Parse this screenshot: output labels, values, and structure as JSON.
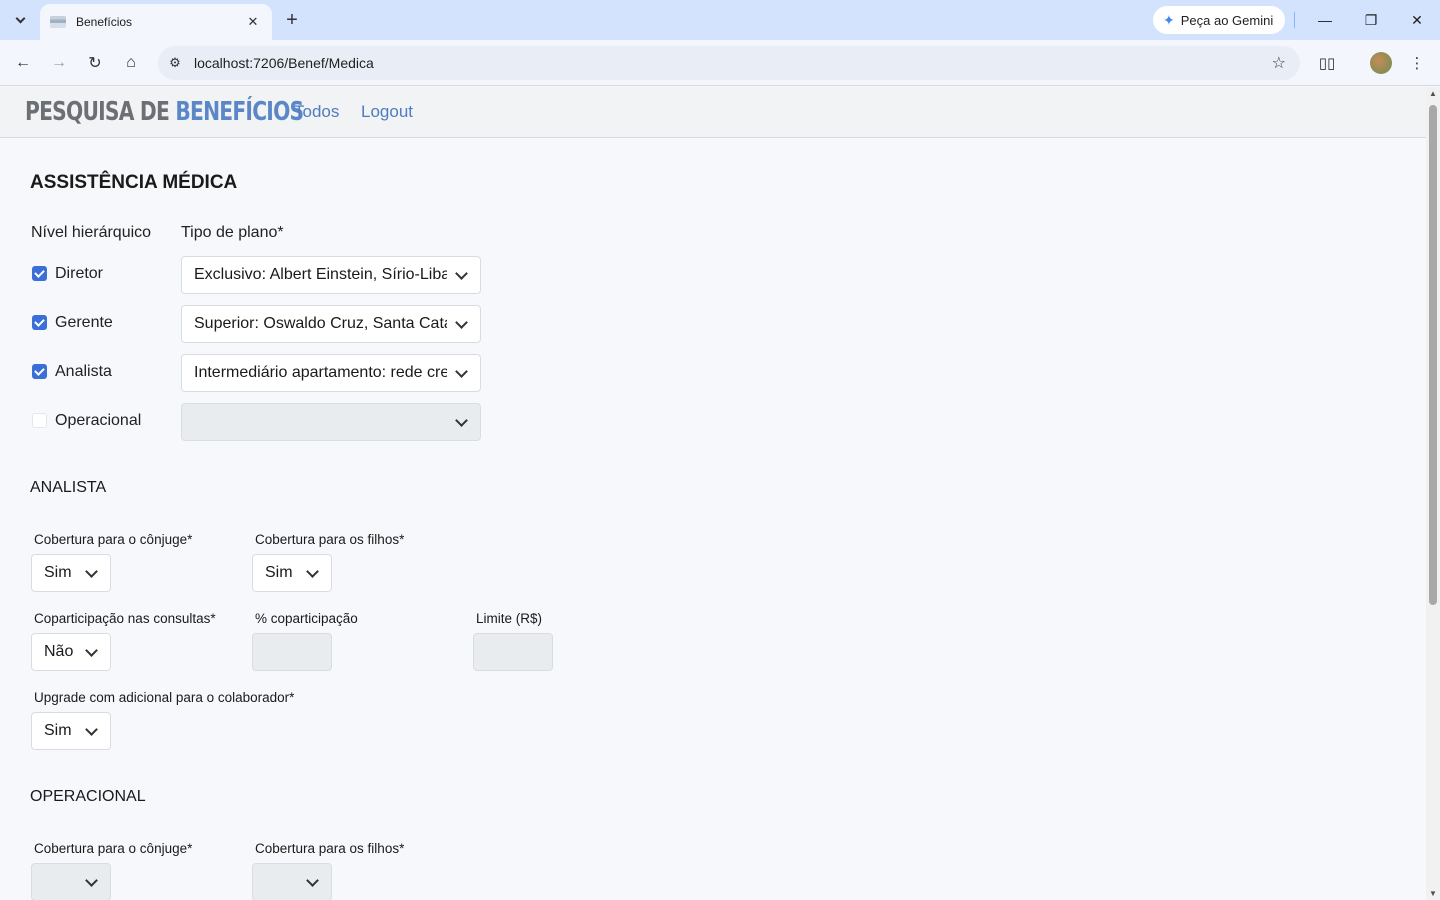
{
  "browser": {
    "tab_title": "Benefícios",
    "url": "localhost:7206/Benef/Medica",
    "gemini_label": "Peça ao Gemini"
  },
  "app": {
    "brand_gray": "PESQUISA DE",
    "brand_blue": "BENEFÍCIOS",
    "nav": [
      "Todos",
      "Logout"
    ]
  },
  "page": {
    "title": "ASSISTÊNCIA MÉDICA",
    "col_nivel": "Nível hierárquico",
    "col_tipo": "Tipo de plano*",
    "rows": [
      {
        "label": "Diretor",
        "checked": true,
        "plan": "Exclusivo: Albert Einstein, Sírio-Libanês"
      },
      {
        "label": "Gerente",
        "checked": true,
        "plan": "Superior: Oswaldo Cruz, Santa Catarina"
      },
      {
        "label": "Analista",
        "checked": true,
        "plan": "Intermediário apartamento: rede credenciada"
      },
      {
        "label": "Operacional",
        "checked": false,
        "plan": ""
      }
    ]
  },
  "analista": {
    "title": "ANALISTA",
    "conjuge_label": "Cobertura para o cônjuge*",
    "conjuge_value": "Sim",
    "filhos_label": "Cobertura para os filhos*",
    "filhos_value": "Sim",
    "copart_label": "Coparticipação nas consultas*",
    "copart_value": "Não",
    "pct_label": "% coparticipação",
    "limite_label": "Limite (R$)",
    "upgrade_label": "Upgrade com adicional para o colaborador*",
    "upgrade_value": "Sim"
  },
  "operacional": {
    "title": "OPERACIONAL",
    "conjuge_label": "Cobertura para o cônjuge*",
    "filhos_label": "Cobertura para os filhos*"
  },
  "colors": {
    "accent": "#3b6fd8",
    "link": "#4f7cc2",
    "brand_blue": "#5b87c9",
    "brand_gray": "#6c7075"
  }
}
